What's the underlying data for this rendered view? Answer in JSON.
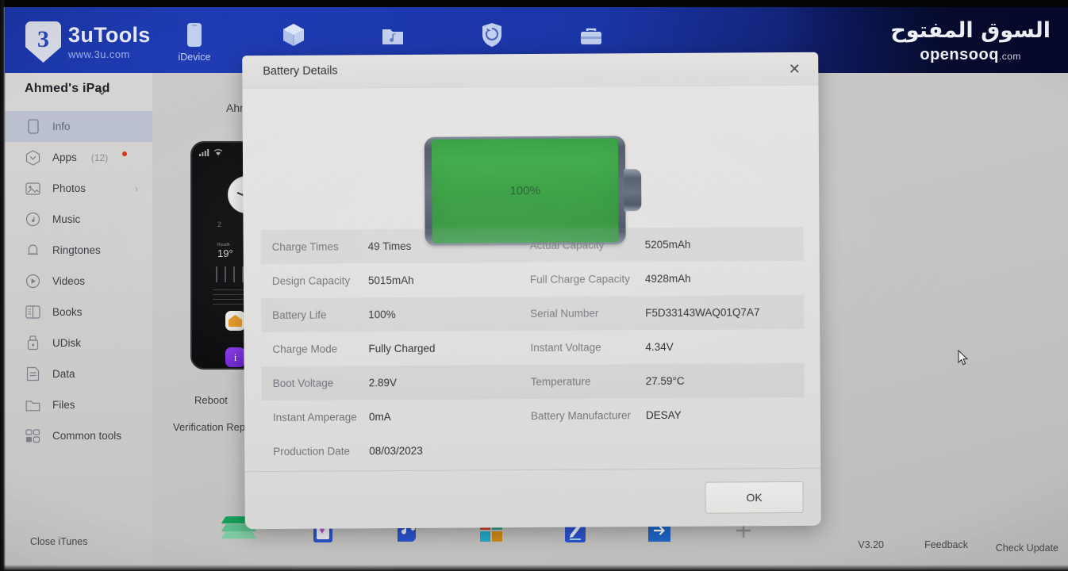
{
  "app": {
    "logo_mark": "3",
    "logo_title": "3uTools",
    "logo_sub": "www.3u.com",
    "accent_blue": "#1f3cb4",
    "battery_green": "#34a33f"
  },
  "watermark": {
    "arabic": "السوق المفتوح",
    "latin": "opensooq",
    "tld": ".com"
  },
  "topbar": {
    "items": [
      {
        "label": "iDevice",
        "icon": "iphone-icon"
      },
      {
        "label": "",
        "icon": "cube-icon"
      },
      {
        "label": "",
        "icon": "ringtone-folder-icon"
      },
      {
        "label": "",
        "icon": "shield-refresh-icon"
      },
      {
        "label": "",
        "icon": "toolbox-icon"
      }
    ]
  },
  "sidebar": {
    "device_name": "Ahmed's iPad",
    "items": [
      {
        "label": "Info",
        "icon": "device-icon",
        "active": true
      },
      {
        "label": "Apps",
        "icon": "apps-icon",
        "count": "(12)",
        "badge": true
      },
      {
        "label": "Photos",
        "icon": "photos-icon",
        "chevron": "›"
      },
      {
        "label": "Music",
        "icon": "music-icon"
      },
      {
        "label": "Ringtones",
        "icon": "bell-icon"
      },
      {
        "label": "Videos",
        "icon": "video-icon"
      },
      {
        "label": "Books",
        "icon": "books-icon"
      },
      {
        "label": "UDisk",
        "icon": "udisk-icon"
      },
      {
        "label": "Data",
        "icon": "data-icon"
      },
      {
        "label": "Files",
        "icon": "folder-icon"
      },
      {
        "label": "Common tools",
        "icon": "grid-icon"
      }
    ]
  },
  "main": {
    "title": "Ahmed's iPad",
    "reboot_label": "Reboot",
    "verification_label": "Verification Repo",
    "device_preview": {
      "clock_label": "",
      "page_number": "2",
      "weather_temp": "19°",
      "weather_city": "Riyadh"
    }
  },
  "bottombar": {
    "close_itunes": "Close iTunes",
    "version": "V3.20",
    "feedback": "Feedback",
    "check_update": "Check Update"
  },
  "modal": {
    "title": "Battery Details",
    "close_glyph": "✕",
    "battery_percent": "100%",
    "ok_label": "OK",
    "rows": [
      {
        "key": "Charge Times",
        "value": "49 Times",
        "key2": "Actual Capacity",
        "value2": "5205mAh"
      },
      {
        "key": "Design Capacity",
        "value": "5015mAh",
        "key2": "Full Charge Capacity",
        "value2": "4928mAh"
      },
      {
        "key": "Battery Life",
        "value": "100%",
        "key2": "Serial Number",
        "value2": "F5D33143WAQ01Q7A7"
      },
      {
        "key": "Charge Mode",
        "value": "Fully Charged",
        "key2": "Instant Voltage",
        "value2": "4.34V"
      },
      {
        "key": "Boot Voltage",
        "value": "2.89V",
        "key2": "Temperature",
        "value2": "27.59°C"
      },
      {
        "key": "Instant Amperage",
        "value": "0mA",
        "key2": "Battery Manufacturer",
        "value2": "DESAY"
      },
      {
        "key": "Production Date",
        "value": "08/03/2023",
        "key2": "",
        "value2": ""
      }
    ]
  }
}
